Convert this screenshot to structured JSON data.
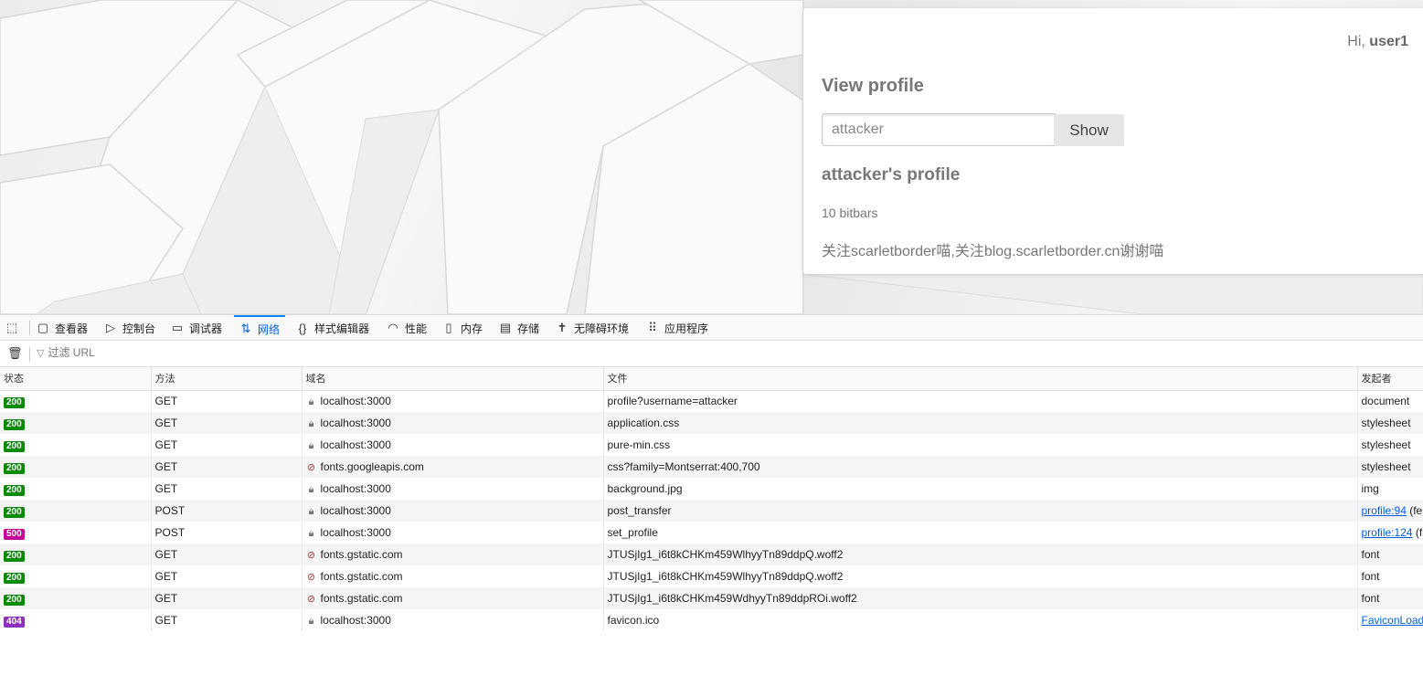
{
  "page": {
    "greeting_prefix": "Hi, ",
    "username": "user1",
    "view_profile_title": "View profile",
    "search_value": "attacker",
    "show_button": "Show",
    "profile_title": "attacker's profile",
    "bitbars": "10 bitbars",
    "bio": "关注scarletborder喵,关注blog.scarletborder.cn谢谢喵"
  },
  "devtools": {
    "tabs": [
      {
        "label": "查看器",
        "icon": "inspector-icon"
      },
      {
        "label": "控制台",
        "icon": "console-icon"
      },
      {
        "label": "调试器",
        "icon": "debugger-icon"
      },
      {
        "label": "网络",
        "icon": "network-icon",
        "active": true
      },
      {
        "label": "样式编辑器",
        "icon": "style-editor-icon"
      },
      {
        "label": "性能",
        "icon": "performance-icon"
      },
      {
        "label": "内存",
        "icon": "memory-icon"
      },
      {
        "label": "存储",
        "icon": "storage-icon"
      },
      {
        "label": "无障碍环境",
        "icon": "accessibility-icon"
      },
      {
        "label": "应用程序",
        "icon": "application-icon"
      }
    ],
    "filter_placeholder": "过滤 URL",
    "columns": [
      "状态",
      "方法",
      "域名",
      "文件",
      "发起者"
    ],
    "status_colors": {
      "200": "#058b00",
      "500": "#c30099",
      "404": "#8e2fc2"
    },
    "requests": [
      {
        "status": "200",
        "method": "GET",
        "domain": "localhost:3000",
        "secure": true,
        "file": "profile?username=attacker",
        "initiator": "document",
        "initiator_link": false
      },
      {
        "status": "200",
        "method": "GET",
        "domain": "localhost:3000",
        "secure": true,
        "file": "application.css",
        "initiator": "stylesheet",
        "initiator_link": false
      },
      {
        "status": "200",
        "method": "GET",
        "domain": "localhost:3000",
        "secure": true,
        "file": "pure-min.css",
        "initiator": "stylesheet",
        "initiator_link": false
      },
      {
        "status": "200",
        "method": "GET",
        "domain": "fonts.googleapis.com",
        "secure": false,
        "file": "css?family=Montserrat:400,700",
        "initiator": "stylesheet",
        "initiator_link": false
      },
      {
        "status": "200",
        "method": "GET",
        "domain": "localhost:3000",
        "secure": true,
        "file": "background.jpg",
        "initiator": "img",
        "initiator_link": false
      },
      {
        "status": "200",
        "method": "POST",
        "domain": "localhost:3000",
        "secure": true,
        "file": "post_transfer",
        "initiator": "profile:94",
        "initiator_suffix": " (fe",
        "initiator_link": true
      },
      {
        "status": "500",
        "method": "POST",
        "domain": "localhost:3000",
        "secure": true,
        "file": "set_profile",
        "initiator": "profile:124",
        "initiator_suffix": " (f",
        "initiator_link": true
      },
      {
        "status": "200",
        "method": "GET",
        "domain": "fonts.gstatic.com",
        "secure": false,
        "file": "JTUSjIg1_i6t8kCHKm459WlhyyTn89ddpQ.woff2",
        "initiator": "font",
        "initiator_link": false
      },
      {
        "status": "200",
        "method": "GET",
        "domain": "fonts.gstatic.com",
        "secure": false,
        "file": "JTUSjIg1_i6t8kCHKm459WlhyyTn89ddpQ.woff2",
        "initiator": "font",
        "initiator_link": false
      },
      {
        "status": "200",
        "method": "GET",
        "domain": "fonts.gstatic.com",
        "secure": false,
        "file": "JTUSjIg1_i6t8kCHKm459WdhyyTn89ddpROi.woff2",
        "initiator": "font",
        "initiator_link": false
      },
      {
        "status": "404",
        "method": "GET",
        "domain": "localhost:3000",
        "secure": true,
        "file": "favicon.ico",
        "initiator": "FaviconLoade",
        "initiator_link": true
      }
    ]
  }
}
